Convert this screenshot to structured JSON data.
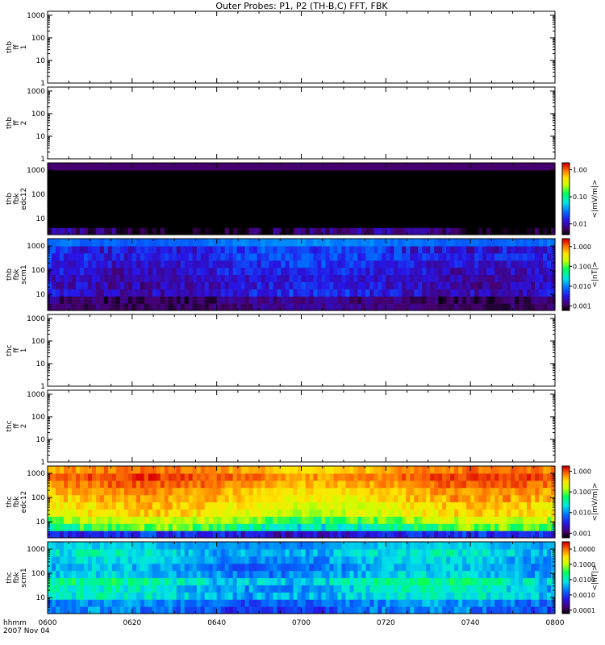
{
  "title": "Outer Probes: P1, P2 (TH-B,C) FFT, FBK",
  "time_axis": {
    "ticks": [
      "0600",
      "0620",
      "0640",
      "0700",
      "0720",
      "0740",
      "0800"
    ],
    "row_label": "hhmm",
    "date_label": "2007 Nov 04"
  },
  "chart_data": [
    {
      "type": "heatmap",
      "id": "thb_ff1",
      "ylabel": [
        "thb",
        "ff",
        "1"
      ],
      "yscale": "log",
      "ylim": [
        1,
        1500
      ],
      "y_ticks": [
        "1",
        "10",
        "100",
        "1000"
      ],
      "empty": true
    },
    {
      "type": "heatmap",
      "id": "thb_ff2",
      "ylabel": [
        "thb",
        "ff",
        "2"
      ],
      "yscale": "log",
      "ylim": [
        1,
        1500
      ],
      "y_ticks": [
        "1",
        "10",
        "100",
        "1000"
      ],
      "empty": true
    },
    {
      "type": "heatmap",
      "id": "thb_fbk_edc12",
      "ylabel": [
        "thb",
        "fbk",
        "edc12"
      ],
      "yscale": "log",
      "ylim": [
        2.2,
        2000
      ],
      "y_ticks": [
        "10",
        "100",
        "1000"
      ],
      "colorbar": {
        "label": "<|mV/m|>",
        "ticks": [
          "0.01",
          "0.10",
          "1.00"
        ],
        "log_range": [
          0.004,
          1.8
        ]
      },
      "bands": [
        {
          "base": 0.006,
          "var": 0.3,
          "noise": 0.4
        },
        {
          "base": 0.001,
          "var": 0.0,
          "noise": 0.0
        },
        {
          "base": 0.001,
          "var": 0.0,
          "noise": 0.0
        },
        {
          "base": 0.001,
          "var": 0.0,
          "noise": 0.0
        },
        {
          "base": 0.001,
          "var": 0.0,
          "noise": 0.0
        },
        {
          "base": 0.001,
          "var": 0.0,
          "noise": 0.0
        },
        {
          "base": 0.001,
          "var": 0.0,
          "noise": 0.0
        },
        {
          "base": 0.001,
          "var": 0.0,
          "noise": 0.0
        },
        {
          "base": 0.001,
          "var": 0.0,
          "noise": 0.0
        },
        {
          "base": 0.0065,
          "var": 0.0,
          "noise": 0.0
        }
      ]
    },
    {
      "type": "heatmap",
      "id": "thb_fbk_scm1",
      "ylabel": [
        "thb",
        "fbk",
        "scm1"
      ],
      "yscale": "log",
      "ylim": [
        2.2,
        2000
      ],
      "y_ticks": [
        "10",
        "100",
        "1000"
      ],
      "colorbar": {
        "label": "<|nT|>",
        "ticks": [
          "0.001",
          "0.010",
          "0.100",
          "1.000"
        ],
        "log_range": [
          0.0006,
          2.5
        ]
      },
      "bands": [
        {
          "base": 0.0013,
          "var": 0.2,
          "noise": 0.3
        },
        {
          "base": 0.0012,
          "var": 0.2,
          "noise": 0.4
        },
        {
          "base": 0.003,
          "var": 0.3,
          "noise": 0.5
        },
        {
          "base": 0.0026,
          "var": 0.3,
          "noise": 0.5
        },
        {
          "base": 0.0024,
          "var": 0.2,
          "noise": 0.4
        },
        {
          "base": 0.003,
          "var": 0.3,
          "noise": 0.5
        },
        {
          "base": 0.0035,
          "var": 0.3,
          "noise": 0.5
        },
        {
          "base": 0.0045,
          "var": 0.3,
          "noise": 0.5
        },
        {
          "base": 0.004,
          "var": 0.3,
          "noise": 0.6
        },
        {
          "base": 0.009,
          "var": 0.2,
          "noise": 0.2
        }
      ]
    },
    {
      "type": "heatmap",
      "id": "thc_ff1",
      "ylabel": [
        "thc",
        "ff",
        "1"
      ],
      "yscale": "log",
      "ylim": [
        1,
        1500
      ],
      "y_ticks": [
        "1",
        "10",
        "100",
        "1000"
      ],
      "empty": true
    },
    {
      "type": "heatmap",
      "id": "thc_ff2",
      "ylabel": [
        "thc",
        "ff",
        "2"
      ],
      "yscale": "log",
      "ylim": [
        1,
        1500
      ],
      "y_ticks": [
        "1",
        "10",
        "100",
        "1000"
      ],
      "empty": true
    },
    {
      "type": "heatmap",
      "id": "thc_fbk_edc12",
      "ylabel": [
        "thc",
        "fbk",
        "edc12"
      ],
      "yscale": "log",
      "ylim": [
        2.2,
        2000
      ],
      "y_ticks": [
        "10",
        "100",
        "1000"
      ],
      "colorbar": {
        "label": "<|mV/m|>",
        "ticks": [
          "0.001",
          "0.010",
          "0.100",
          "1.000"
        ],
        "log_range": [
          0.0006,
          1.8
        ]
      },
      "bands": [
        {
          "base": 0.003,
          "var": 0.3,
          "noise": 0.5
        },
        {
          "base": 0.05,
          "var": 0.6,
          "noise": 0.6
        },
        {
          "base": 0.12,
          "var": 0.5,
          "noise": 0.5
        },
        {
          "base": 0.25,
          "var": 0.4,
          "noise": 0.4
        },
        {
          "base": 0.3,
          "var": 0.4,
          "noise": 0.4
        },
        {
          "base": 0.4,
          "var": 0.4,
          "noise": 0.4
        },
        {
          "base": 0.5,
          "var": 0.3,
          "noise": 0.3
        },
        {
          "base": 0.7,
          "var": 0.3,
          "noise": 0.3
        },
        {
          "base": 0.9,
          "var": 0.3,
          "noise": 0.3
        },
        {
          "base": 0.6,
          "var": 0.3,
          "noise": 0.3
        }
      ]
    },
    {
      "type": "heatmap",
      "id": "thc_fbk_scm1",
      "ylabel": [
        "thc",
        "fbk",
        "scm1"
      ],
      "yscale": "log",
      "ylim": [
        2.2,
        2000
      ],
      "y_ticks": [
        "10",
        "100",
        "1000"
      ],
      "colorbar": {
        "label": "<|nT|>",
        "ticks": [
          "0.0001",
          "0.0010",
          "0.0100",
          "0.1000",
          "1.0000"
        ],
        "log_range": [
          6e-05,
          3
        ]
      },
      "bands": [
        {
          "base": 0.0015,
          "var": 0.5,
          "noise": 0.7
        },
        {
          "base": 0.002,
          "var": 0.4,
          "noise": 0.6
        },
        {
          "base": 0.006,
          "var": 0.5,
          "noise": 0.7
        },
        {
          "base": 0.006,
          "var": 0.6,
          "noise": 0.7
        },
        {
          "base": 0.01,
          "var": 0.6,
          "noise": 0.8
        },
        {
          "base": 0.004,
          "var": 0.5,
          "noise": 0.6
        },
        {
          "base": 0.003,
          "var": 0.5,
          "noise": 0.6
        },
        {
          "base": 0.004,
          "var": 0.5,
          "noise": 0.6
        },
        {
          "base": 0.006,
          "var": 0.5,
          "noise": 0.7
        },
        {
          "base": 0.004,
          "var": 0.4,
          "noise": 0.4
        }
      ]
    }
  ]
}
